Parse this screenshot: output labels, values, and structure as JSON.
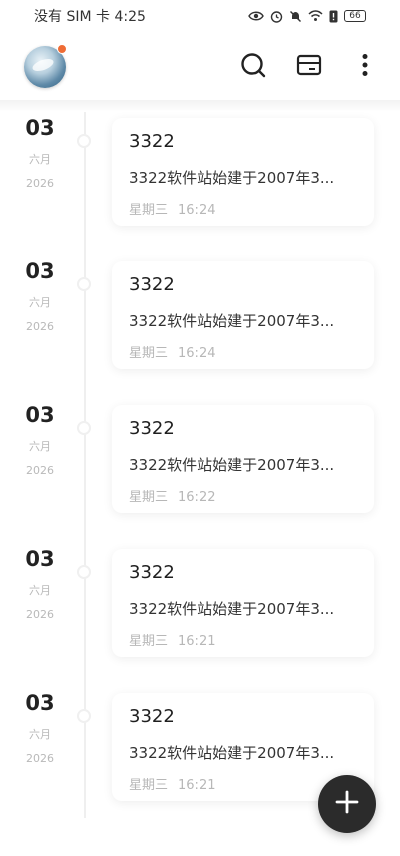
{
  "status_bar": {
    "carrier": "没有 SIM 卡",
    "time": "4:25",
    "battery": "66"
  },
  "icons": {
    "search": "search-icon",
    "notes": "folder-icon",
    "more": "more-vertical-icon",
    "add": "plus-icon"
  },
  "colors": {
    "avatar_badge": "#ef6c35",
    "fab": "#2b2b2b",
    "muted_text": "#b7b7b7"
  },
  "entries": [
    {
      "day": "03",
      "month": "六月",
      "year": "2026",
      "title": "3322",
      "preview": "3322软件站始建于2007年3...",
      "weekday": "星期三",
      "time": "16:24"
    },
    {
      "day": "03",
      "month": "六月",
      "year": "2026",
      "title": "3322",
      "preview": "3322软件站始建于2007年3...",
      "weekday": "星期三",
      "time": "16:24"
    },
    {
      "day": "03",
      "month": "六月",
      "year": "2026",
      "title": "3322",
      "preview": "3322软件站始建于2007年3...",
      "weekday": "星期三",
      "time": "16:22"
    },
    {
      "day": "03",
      "month": "六月",
      "year": "2026",
      "title": "3322",
      "preview": "3322软件站始建于2007年3...",
      "weekday": "星期三",
      "time": "16:21"
    },
    {
      "day": "03",
      "month": "六月",
      "year": "2026",
      "title": "3322",
      "preview": "3322软件站始建于2007年3...",
      "weekday": "星期三",
      "time": "16:21"
    }
  ]
}
